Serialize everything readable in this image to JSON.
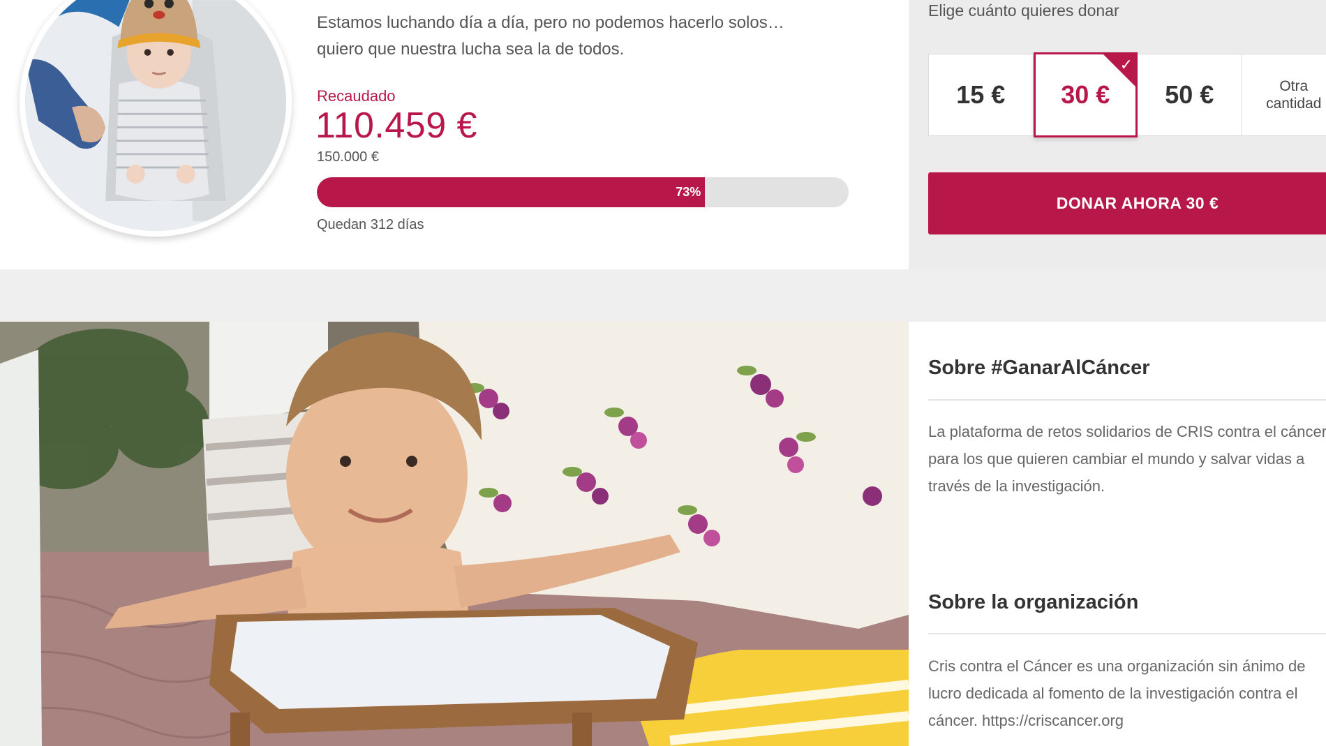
{
  "campaign": {
    "story_line1": "Estamos luchando día a día, pero no podemos hacerlo solos…",
    "story_line2": "quiero que nuestra lucha sea la de todos.",
    "raised_label": "Recaudado",
    "raised_amount": "110.459 €",
    "goal_amount": "150.000 €",
    "progress_label": "73%",
    "progress_fraction": 0.73,
    "days_left": "Quedan 312 días"
  },
  "donate": {
    "heading": "Elige cuánto quieres donar",
    "options": [
      {
        "label": "15 €"
      },
      {
        "label": "30 €",
        "selected": true
      },
      {
        "label": "50 €"
      },
      {
        "label_line1": "Otra",
        "label_line2": "cantidad"
      }
    ],
    "check_icon": "✓",
    "button_label": "DONAR AHORA 30 €"
  },
  "about": {
    "platform_title": "Sobre #GanarAlCáncer",
    "platform_text": "La plataforma de retos solidarios de CRIS contra el cáncer para los que quieren cambiar el mundo y salvar vidas a través de la investigación.",
    "org_title": "Sobre la organización",
    "org_text": "Cris contra el Cáncer es una organización sin ánimo de lucro dedicada al fomento de la investigación contra el cáncer. https://criscancer.org"
  },
  "colors": {
    "accent": "#b8174a",
    "track": "#e2e2e2",
    "panel_bg": "#ececec"
  }
}
